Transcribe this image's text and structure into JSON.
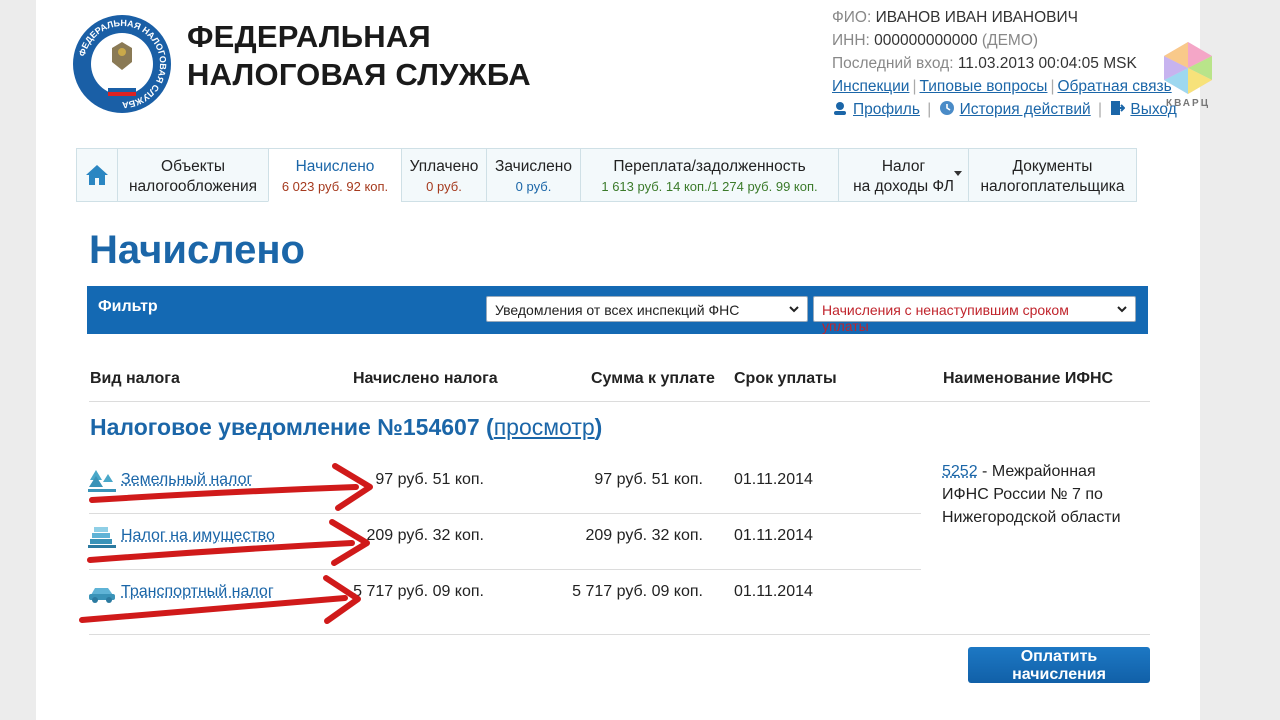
{
  "brand": {
    "line1": "ФЕДЕРАЛЬНАЯ",
    "line2": "НАЛОГОВАЯ СЛУЖБА",
    "emblem_text": "ФЕДЕРАЛЬНАЯ НАЛОГОВАЯ СЛУЖБА",
    "watermark": "КВАРЦ"
  },
  "user": {
    "fio_label": "ФИО:",
    "fio_value": "ИВАНОВ ИВАН ИВАНОВИЧ",
    "inn_label": "ИНН:",
    "inn_value": "000000000000",
    "inn_note": "(ДЕМО)",
    "last_login_label": "Последний вход:",
    "last_login_value": "11.03.2013 00:04:05 MSK",
    "links": [
      "Инспекции",
      "Типовые вопросы",
      "Обратная связь"
    ],
    "profile": "Профиль",
    "history": "История действий",
    "logout": "Выход"
  },
  "tabs": [
    {
      "l1": "Объекты",
      "l2": "налогообложения"
    },
    {
      "l1": "Начислено",
      "l2": "6 023 руб. 92 коп."
    },
    {
      "l1": "Уплачено",
      "l2": "0 руб."
    },
    {
      "l1": "Зачислено",
      "l2": "0 руб."
    },
    {
      "l1": "Переплата/задолженность",
      "l2": "1 613 руб. 14 коп./1 274 руб. 99 коп."
    },
    {
      "l1": "Налог",
      "l2": "на доходы ФЛ"
    },
    {
      "l1": "Документы",
      "l2": "налогоплательщика"
    }
  ],
  "page_title": "Начислено",
  "filter": {
    "label": "Фильтр",
    "inspections": "Уведомления от всех инспекций ФНС",
    "period": "Начисления с ненаступившим сроком уплаты"
  },
  "table": {
    "headers": [
      "Вид налога",
      "Начислено налога",
      "Сумма к уплате",
      "Срок уплаты",
      "Наименование ИФНС"
    ],
    "notice_title": "Налоговое уведомление №154607",
    "notice_link": "просмотр",
    "rows": [
      {
        "name": "Земельный налог",
        "accrued": "97 руб. 51 коп.",
        "to_pay": "97 руб. 51 коп.",
        "due": "01.11.2014",
        "icon": "land-icon"
      },
      {
        "name": "Налог на имущество",
        "accrued": "209 руб. 32 коп.",
        "to_pay": "209 руб. 32 коп.",
        "due": "01.11.2014",
        "icon": "property-icon"
      },
      {
        "name": "Транспортный налог",
        "accrued": "5 717 руб. 09 коп.",
        "to_pay": "5 717 руб. 09 коп.",
        "due": "01.11.2014",
        "icon": "car-icon"
      }
    ],
    "ifns_code": "5252",
    "ifns_name": "- Межрайонная ИФНС России № 7 по Нижегородской области"
  },
  "pay_button": "Оплатить начисления",
  "colors": {
    "primary": "#1b66a8",
    "filter_bar": "#1469b3",
    "accent_red": "#c0242c",
    "annotation": "#d01a1a"
  }
}
